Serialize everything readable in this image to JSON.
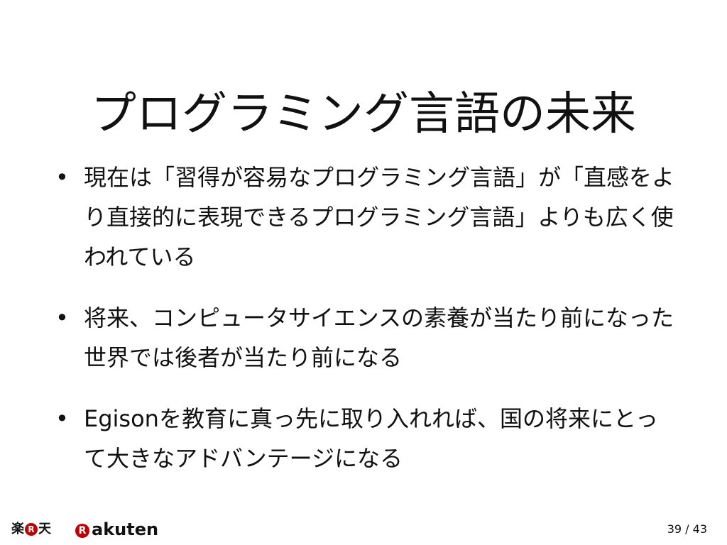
{
  "slide": {
    "title": "プログラミング言語の未来",
    "bullet_symbol": "•",
    "bullets": [
      {
        "text": "現在は「習得が容易なプログラミング言語」が「直感をより直接的に表現できるプログラミング言語」よりも広く使われている"
      },
      {
        "text": "将来、コンピュータサイエンスの素養が当たり前になった世界では後者が当たり前になる"
      },
      {
        "text": "Egisonを教育に真っ先に取り入れれば、国の将来にとって大きなアドバンテージになる"
      }
    ]
  },
  "footer": {
    "logo_kanji_left": "楽",
    "logo_kanji_badge": "R",
    "logo_kanji_right": "天",
    "logo_badge": "R",
    "logo_word": "akuten",
    "brand_color": "#bf0000",
    "page_current": "39",
    "page_separator": "/",
    "page_total": "43"
  }
}
